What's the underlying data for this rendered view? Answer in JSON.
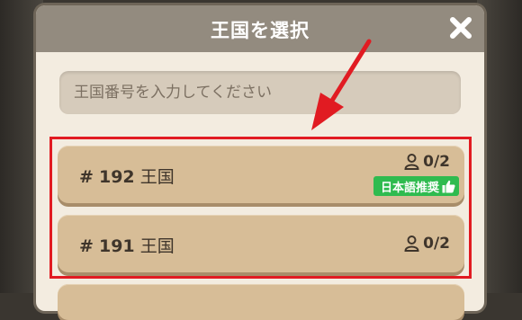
{
  "dialog": {
    "title": "王国を選択",
    "close_icon": "close-icon"
  },
  "search": {
    "placeholder": "王国番号を入力してください",
    "value": ""
  },
  "kingdoms": [
    {
      "hash": "#",
      "number": "192",
      "suffix": "王国",
      "players": "0/2",
      "badge": "日本語推奨"
    },
    {
      "hash": "#",
      "number": "191",
      "suffix": "王国",
      "players": "0/2"
    }
  ],
  "colors": {
    "highlight": "#e11b22",
    "badge": "#2fbb4f",
    "row": "#d7bd97",
    "header": "#938b7f"
  }
}
